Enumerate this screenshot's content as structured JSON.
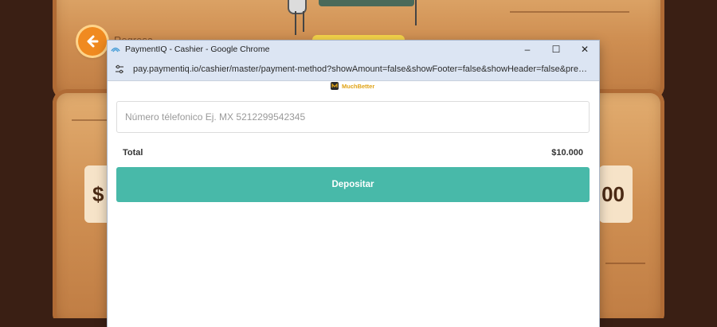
{
  "background": {
    "back_label": "Regresa",
    "amount_left": "$",
    "amount_right": "00"
  },
  "window": {
    "title": "PaymentIQ - Cashier - Google Chrome",
    "url": "pay.paymentiq.io/cashier/master/payment-method?showAmount=false&showFooter=false&showHeader=false&pred...",
    "controls": {
      "minimize": "–",
      "maximize": "☐",
      "close": "✕"
    }
  },
  "payment": {
    "provider": "MuchBetter",
    "phone_placeholder": "Número télefonico Ej. MX 5212299542345",
    "phone_value": "",
    "total_label": "Total",
    "total_value": "$10.000",
    "deposit_label": "Depositar"
  },
  "colors": {
    "accent": "#48b9a9",
    "titlebar": "#dce5f3",
    "provider_brand": "#e0a316"
  },
  "icons": {
    "favicon": "paymentiq-favicon-icon",
    "site_info": "site-settings-icon",
    "back": "arrow-left-icon",
    "provider": "muchbetter-logo-icon"
  }
}
